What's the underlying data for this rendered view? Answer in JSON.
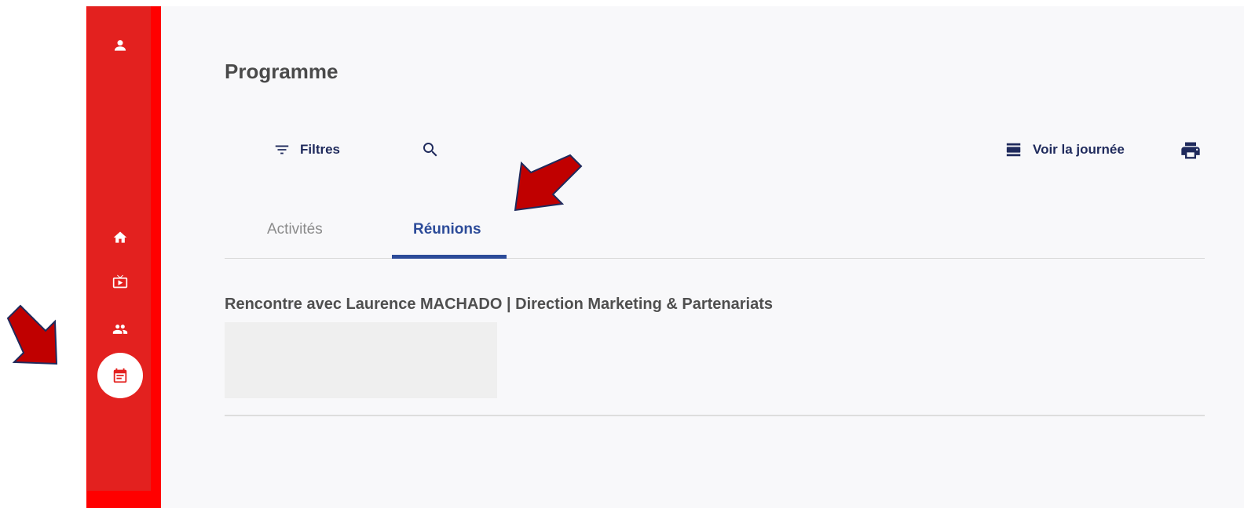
{
  "page": {
    "title": "Programme"
  },
  "toolbar": {
    "filters_label": "Filtres",
    "view_day_label": "Voir la journée"
  },
  "tabs": [
    {
      "label": "Activités",
      "active": false
    },
    {
      "label": "Réunions",
      "active": true
    }
  ],
  "meetings": [
    {
      "title": "Rencontre avec Laurence MACHADO | Direction Marketing & Partenariats"
    }
  ],
  "sidebar": {
    "items": [
      {
        "icon": "person-icon"
      },
      {
        "icon": "home-icon"
      },
      {
        "icon": "tv-icon"
      },
      {
        "icon": "people-icon"
      },
      {
        "icon": "calendar-icon",
        "active": true
      }
    ]
  },
  "colors": {
    "sidebar": "#e3211f",
    "sidebar_border": "#ff0000",
    "accent": "#2c4b99",
    "toolbar_text": "#1f2a5c",
    "annotation_arrow": "#c00000"
  }
}
